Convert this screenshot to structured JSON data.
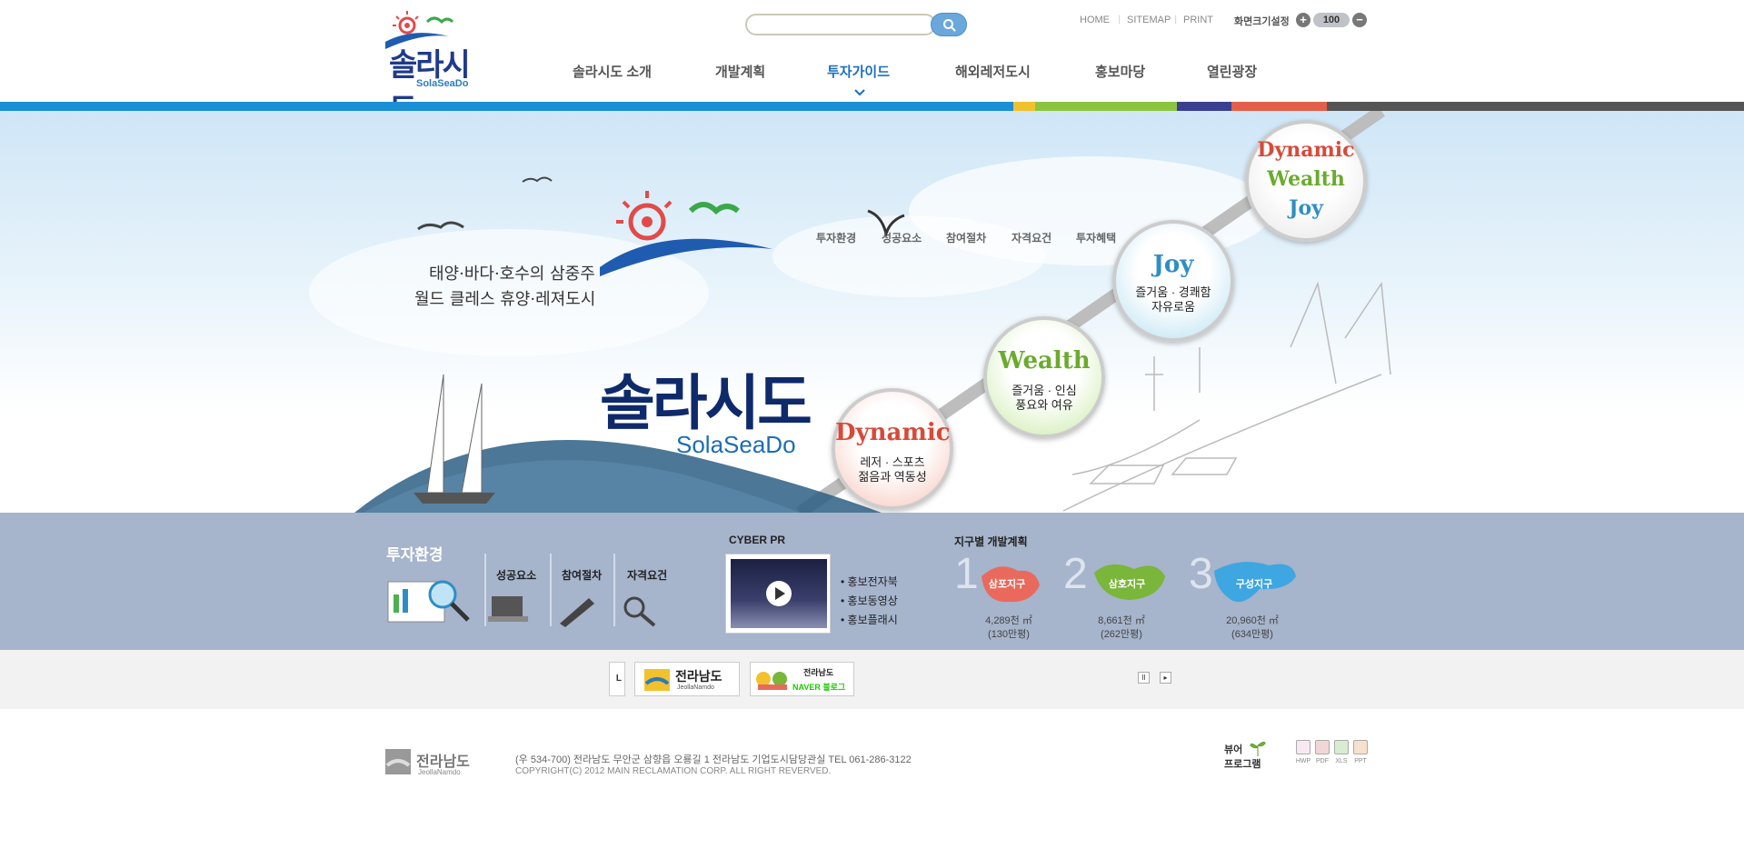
{
  "header": {
    "logo_text": "솔라시도",
    "logo_sub": "SolaSeaDo",
    "search": {
      "placeholder": ""
    },
    "util_links": [
      "HOME",
      "SITEMAP",
      "PRINT"
    ],
    "zoom_label": "화면크기설정",
    "zoom_value": "100",
    "zoom_in": "+",
    "zoom_out": "−"
  },
  "nav": {
    "items": [
      "솔라시도 소개",
      "개발계획",
      "투자가이드",
      "해외레저도시",
      "홍보마당",
      "열린광장"
    ],
    "active_index": 2,
    "sub_items": [
      "투자환경",
      "성공요소",
      "참여절차",
      "자격요건",
      "투자혜택"
    ]
  },
  "colors": {
    "accent": "#1d6fbe",
    "stripe": [
      "#1a8fd6",
      "#f2c12e",
      "#8bc540",
      "#3a3f8f",
      "#e2604a",
      "#555555"
    ],
    "band": "#a6b4cc"
  },
  "hero": {
    "slogan_line1": "태양·바다·호수의 삼중주",
    "slogan_line2": "월드 클레스 휴양·레져도시",
    "logo_text": "솔라시도",
    "logo_sub": "SolaSeaDo",
    "bubbles": [
      {
        "title": "Dynamic",
        "cap1": "레저 · 스포츠",
        "cap2": "젊음과 역동성"
      },
      {
        "title": "Wealth",
        "cap1": "즐거움 · 인심",
        "cap2": "풍요와 여유"
      },
      {
        "title": "Joy",
        "cap1": "즐거움 · 경쾌함",
        "cap2": "자유로움"
      }
    ],
    "combo": [
      "Dynamic",
      "Wealth",
      "Joy"
    ]
  },
  "investment": {
    "title": "투자환경",
    "items": [
      "성공요소",
      "참여절차",
      "자격요건"
    ]
  },
  "cyber_pr": {
    "title": "CYBER PR",
    "links": [
      "• 홍보전자북",
      "• 홍보동영상",
      "• 홍보플래시"
    ]
  },
  "districts": {
    "title": "지구별 개발계획",
    "items": [
      {
        "num": "1",
        "name": "삼포지구",
        "area": "4,289천 ㎡",
        "pyeong": "(130만평)"
      },
      {
        "num": "2",
        "name": "삼호지구",
        "area": "8,661천 ㎡",
        "pyeong": "(262만평)"
      },
      {
        "num": "3",
        "name": "구성지구",
        "area": "20,960천 ㎡",
        "pyeong": "(634만평)"
      }
    ]
  },
  "banners": {
    "partial": "L",
    "jeonnam": "전라남도",
    "jeonnam_sub": "JeollaNamdo",
    "blog_top": "전라남도",
    "blog_bottom": "NAVER 블로그",
    "pause": "II",
    "next": "▸"
  },
  "footer": {
    "logo_text": "전라남도",
    "logo_sub": "JeollaNamdo",
    "address": "(우 534-700) 전라남도 무안군 삼향읍 오룡길 1 전라남도 기업도시담당관실 TEL 061-286-3122",
    "copyright": "COPYRIGHT(C) 2012 MAIN RECLAMATION CORP.  ALL RIGHT REVERVED.",
    "viewer_line1": "뷰어",
    "viewer_line2": "프로그램",
    "doc_types": [
      "HWP",
      "PDF",
      "XLS",
      "PPT"
    ]
  }
}
